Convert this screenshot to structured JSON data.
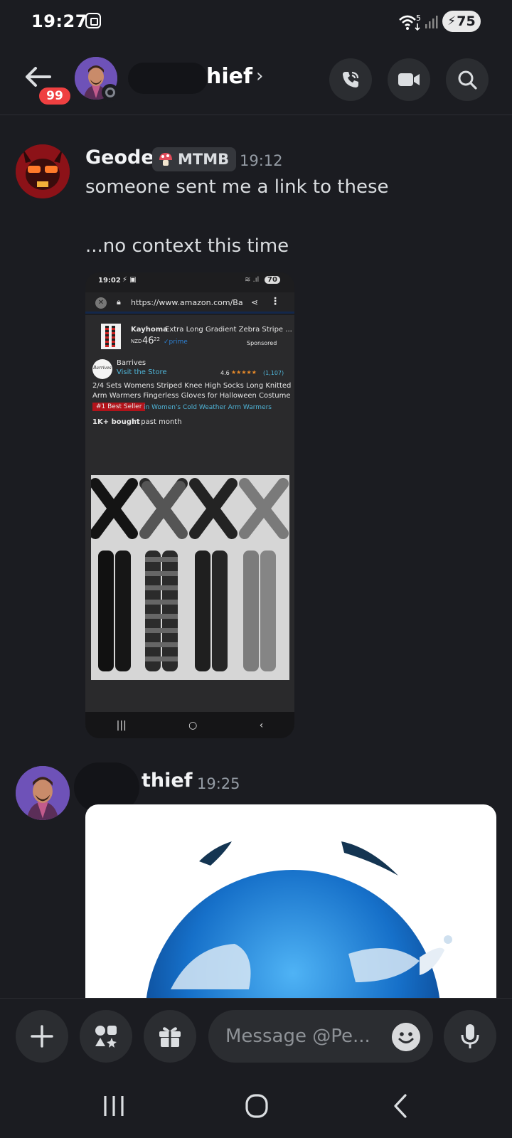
{
  "status_bar": {
    "time": "19:27",
    "battery": "75",
    "wifi_label": "5"
  },
  "header": {
    "back_badge": "99",
    "name_visible": "hief",
    "chevron": "›",
    "icons": [
      "call-icon",
      "video-icon",
      "search-icon"
    ]
  },
  "messages": [
    {
      "username": "Geode",
      "tag": "MTMB",
      "time": "19:12",
      "lines": [
        "someone sent me a link to these",
        "...no context this time"
      ],
      "attachment": {
        "status_time": "19:02",
        "status_battery": "70",
        "url": "https://www.amazon.com/Ba",
        "sponsored_title_brand": "Kayhoma",
        "sponsored_title_rest": "Extra Long Gradient Zebra Stripe ...",
        "sponsored_price_prefix": "NZD",
        "sponsored_price_main": "46",
        "sponsored_price_cents": "22",
        "sponsored_prime": "✓prime",
        "sponsored_label": "Sponsored",
        "store_name": "Barrives",
        "store_logo": "Barrives",
        "visit_store": "Visit the Store",
        "rating": "4.6",
        "stars": "★★★★★",
        "review_count": "(1,107)",
        "product_title_line1": "2/4 Sets Womens Striped Knee High Socks Long Knitted",
        "product_title_line2": "Arm Warmers Fingerless Gloves for Halloween Costume",
        "best_seller": "#1 Best Seller",
        "best_seller_category": "in Women's Cold Weather Arm Warmers",
        "bought_bold": "1K+ bought",
        "bought_rest": " in past month"
      }
    },
    {
      "username_visible": "thief",
      "time": "19:25"
    }
  ],
  "composer": {
    "placeholder": "Message @Pe...",
    "icons": [
      "plus-icon",
      "apps-icon",
      "gift-icon",
      "emoji-icon",
      "microphone-icon"
    ]
  },
  "nav": {
    "icons": [
      "recents-icon",
      "home-icon",
      "back-nav-icon"
    ]
  },
  "colors": {
    "background": "#1b1c21",
    "surface": "#2b2d31",
    "badge_red": "#ef4041",
    "muted_text": "#949ba4"
  }
}
